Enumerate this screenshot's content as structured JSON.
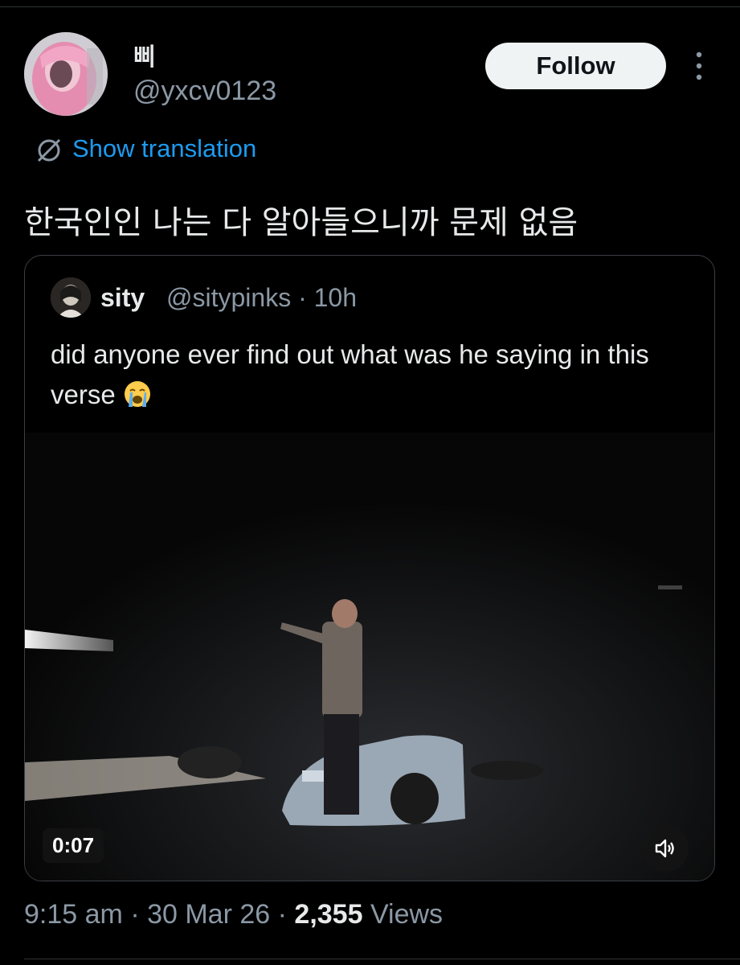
{
  "author": {
    "display_name": "삐",
    "handle": "@yxcv0123"
  },
  "actions": {
    "follow_label": "Follow",
    "more_icon": "more-vertical-icon"
  },
  "translation": {
    "label": "Show translation",
    "icon": "translate-globe-icon"
  },
  "tweet": {
    "text": "한국인인 나는 다 알아들으니까 문제 없음"
  },
  "quoted": {
    "name": "sity",
    "meta": "@sitypinks · 10h",
    "text": "did anyone ever find out what was he saying in this verse",
    "emoji": "loudly-crying-face-emoji",
    "video": {
      "duration": "0:07",
      "volume_icon": "volume-icon"
    }
  },
  "footer": {
    "time": "9:15 am",
    "sep1": "·",
    "date": "30 Mar 26",
    "sep2": "·",
    "views_count": "2,355",
    "views_label": "Views"
  },
  "colors": {
    "background": "#000000",
    "text_primary": "#e7e9ea",
    "text_secondary": "#8b98a5",
    "link": "#1d9bf0",
    "follow_bg": "#eff3f4",
    "border": "#3a3f44"
  }
}
